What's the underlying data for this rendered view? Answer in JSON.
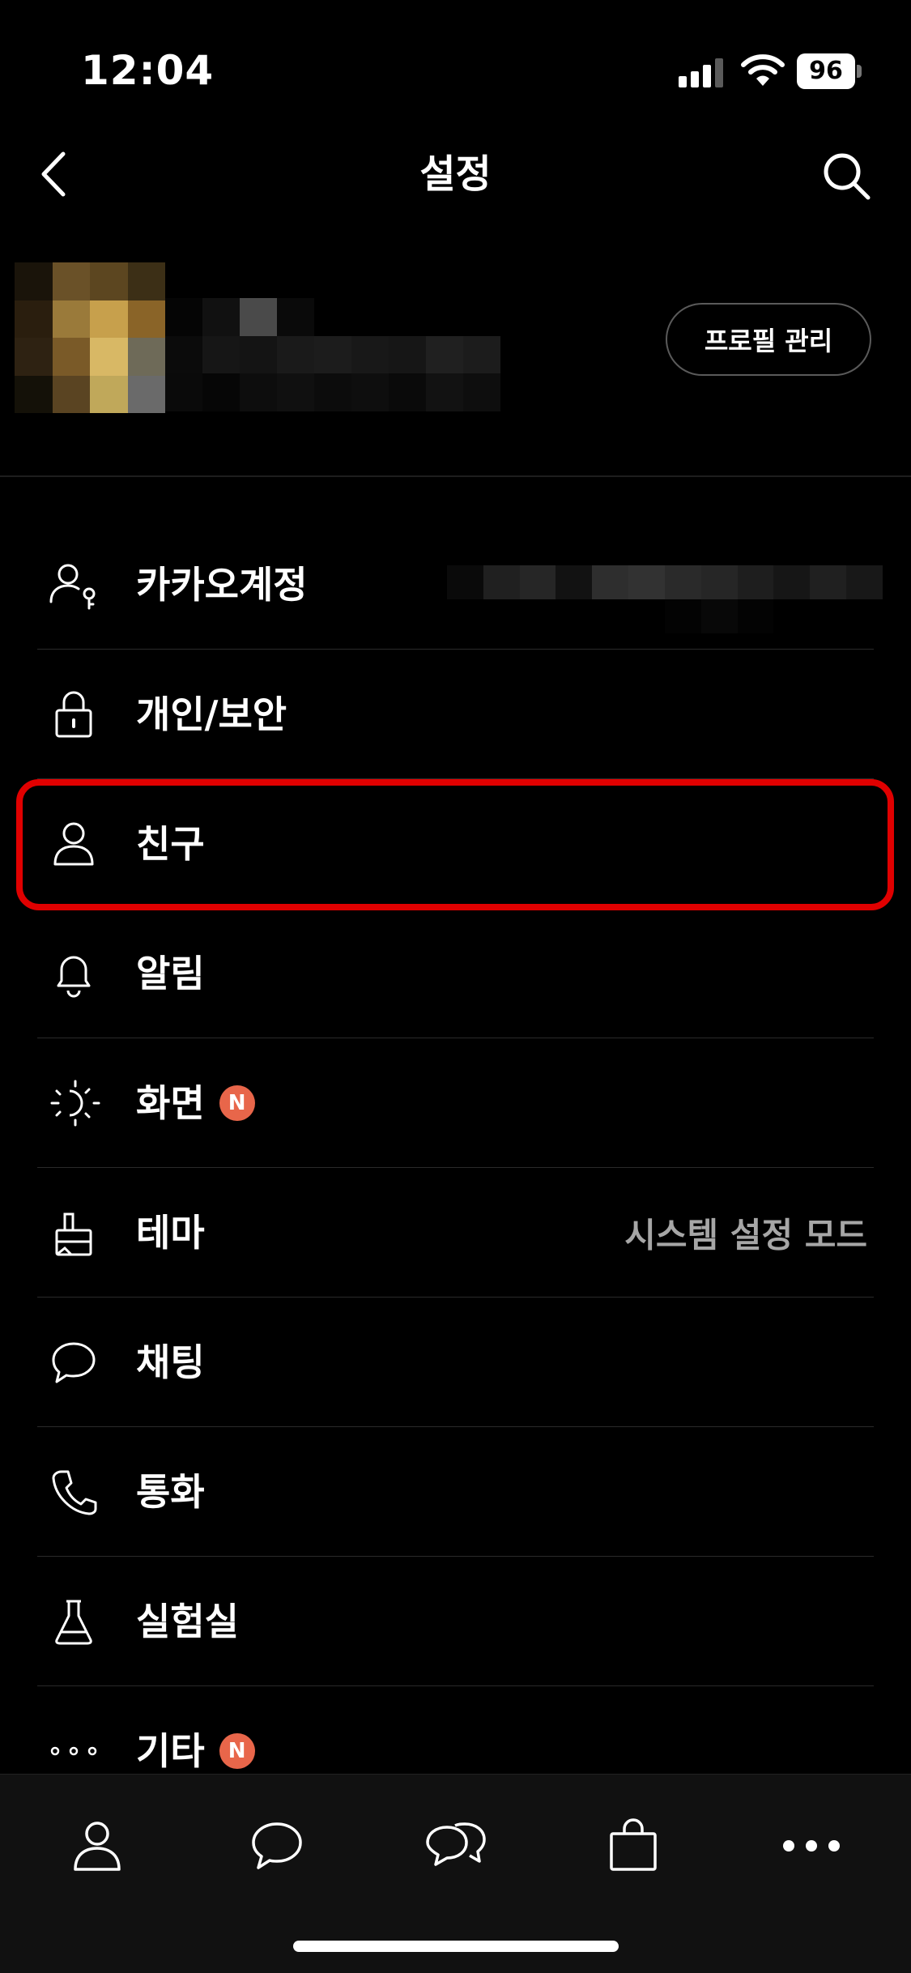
{
  "status_bar": {
    "time": "12:04",
    "battery": "96"
  },
  "header": {
    "title": "설정"
  },
  "profile": {
    "manage_button": "프로필 관리"
  },
  "menu": {
    "items": [
      {
        "id": "account",
        "label": "카카오계정",
        "icon": "person-key-icon"
      },
      {
        "id": "privacy",
        "label": "개인/보안",
        "icon": "lock-icon"
      },
      {
        "id": "friends",
        "label": "친구",
        "icon": "person-icon"
      },
      {
        "id": "notifications",
        "label": "알림",
        "icon": "bell-icon"
      },
      {
        "id": "display",
        "label": "화면",
        "icon": "sun-icon",
        "badge": "N"
      },
      {
        "id": "theme",
        "label": "테마",
        "icon": "brush-icon",
        "value": "시스템 설정 모드"
      },
      {
        "id": "chat",
        "label": "채팅",
        "icon": "chat-bubble-icon"
      },
      {
        "id": "call",
        "label": "통화",
        "icon": "phone-icon"
      },
      {
        "id": "lab",
        "label": "실험실",
        "icon": "flask-icon"
      },
      {
        "id": "etc",
        "label": "기타",
        "icon": "more-icon",
        "badge": "N"
      }
    ]
  },
  "tab_bar": {
    "tabs": [
      {
        "id": "friends",
        "icon": "person-icon"
      },
      {
        "id": "chats",
        "icon": "chat-bubble-icon"
      },
      {
        "id": "openchat",
        "icon": "double-chat-icon"
      },
      {
        "id": "shopping",
        "icon": "shopping-bag-icon"
      },
      {
        "id": "more",
        "icon": "more-icon"
      }
    ]
  },
  "colors": {
    "background": "#000000",
    "badge": "#e8664a",
    "highlight": "#e00000",
    "value_text": "#a6a6a6"
  }
}
